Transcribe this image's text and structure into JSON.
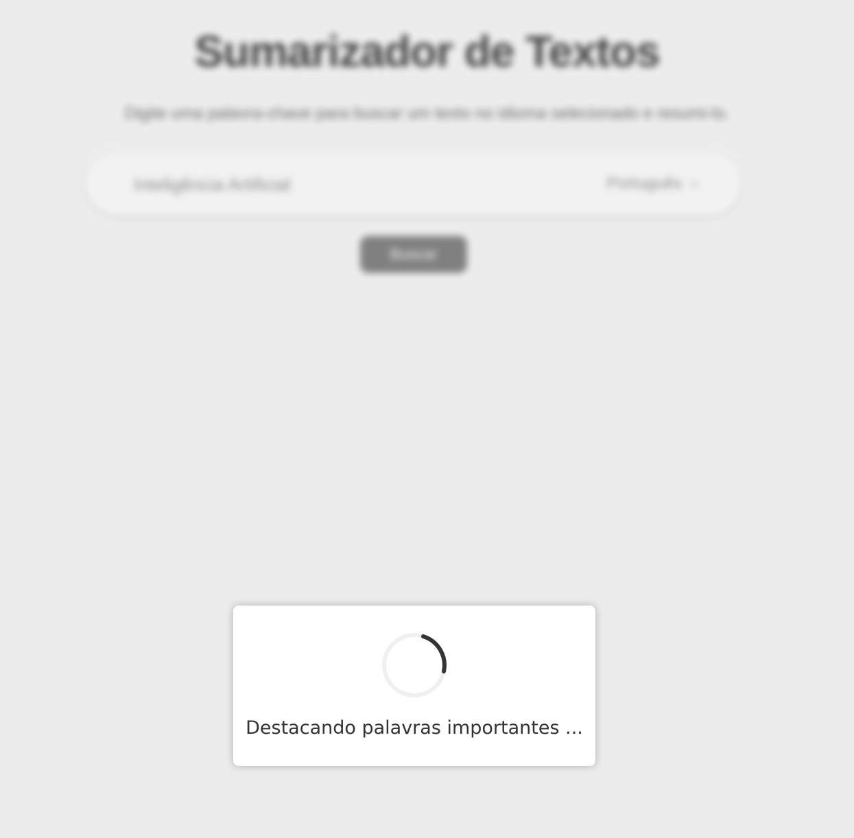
{
  "page": {
    "title": "Sumarizador de Textos",
    "subtitle": "Digite uma palavra-chave para buscar um texto no idioma selecionado e resumi-lo."
  },
  "search": {
    "value": "Inteligência Artificial",
    "language": {
      "selected": "Português",
      "icon": "chevron-down-icon"
    },
    "button_label": "Buscar"
  },
  "loading": {
    "message": "Destacando palavras importantes ...",
    "spinner_icon": "spinner-icon",
    "spinner_track_color": "#f0f0f0",
    "spinner_arc_color": "#333333"
  },
  "colors": {
    "background": "#ececec",
    "dialog_background": "#ffffff",
    "button": "#7b7b7b",
    "title_text": "#3c3c3c"
  }
}
